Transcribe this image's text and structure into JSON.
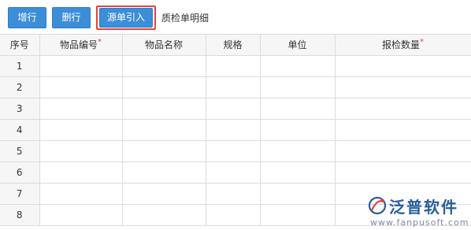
{
  "toolbar": {
    "add_row_label": "增行",
    "delete_row_label": "删行",
    "source_import_label": "源单引入",
    "section_title": "质检单明细",
    "highlight_color": "#e0443e",
    "button_color": "#3d8ed8"
  },
  "table": {
    "columns": [
      {
        "label": "序号",
        "required": ""
      },
      {
        "label": "物品编号",
        "required": "*"
      },
      {
        "label": "物品名称",
        "required": ""
      },
      {
        "label": "规格",
        "required": ""
      },
      {
        "label": "单位",
        "required": ""
      },
      {
        "label": "报检数量",
        "required": "*"
      }
    ],
    "row_numbers": [
      "1",
      "2",
      "3",
      "4",
      "5",
      "6",
      "7",
      "8"
    ]
  },
  "logo": {
    "name": "泛普软件",
    "url": "www.fanpusoft.com",
    "icon": "fanpu-logo-icon"
  }
}
